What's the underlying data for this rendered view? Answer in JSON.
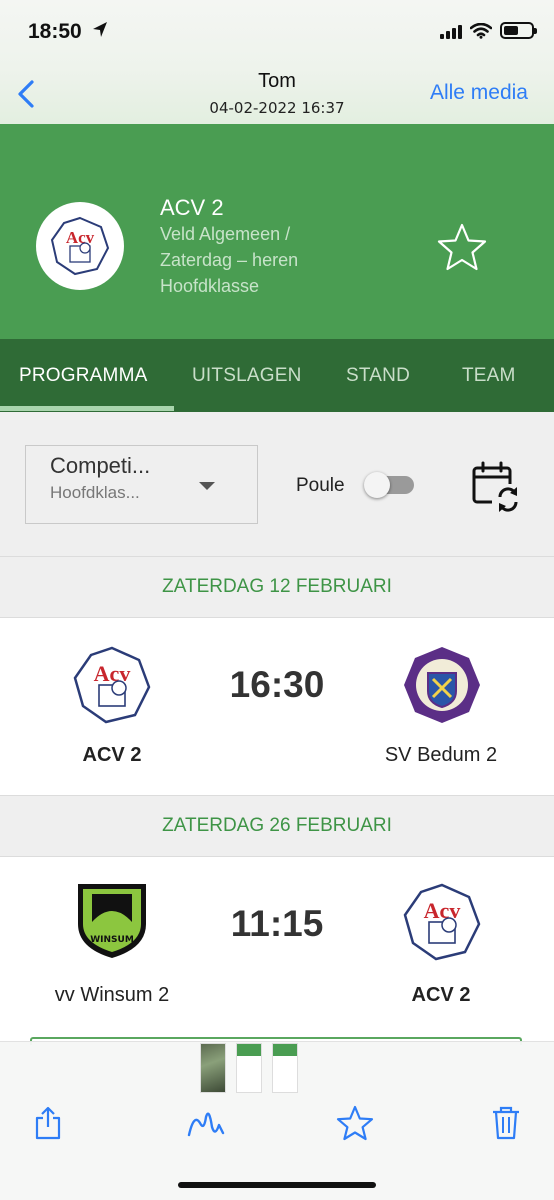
{
  "status_bar": {
    "time": "18:50",
    "icons": [
      "location-arrow-icon",
      "cellular-signal-icon",
      "wifi-icon",
      "battery-icon"
    ]
  },
  "viewer": {
    "title": "Tom",
    "subtitle": "04-02-2022 16:37",
    "right_link": "Alle media",
    "back_icon": "chevron-left-icon"
  },
  "team": {
    "name": "ACV 2",
    "lines": [
      "Veld Algemeen /",
      "Zaterdag – heren",
      "Hoofdklasse"
    ],
    "favorite_icon": "star-outline-icon"
  },
  "tabs": [
    {
      "label": "PROGRAMMA",
      "active": true
    },
    {
      "label": "UITSLAGEN",
      "active": false
    },
    {
      "label": "STAND",
      "active": false
    },
    {
      "label": "TEAM",
      "active": false
    }
  ],
  "filter": {
    "select_main": "Competi...",
    "select_sub": "Hoofdklas...",
    "poule_label": "Poule",
    "poule_on": false,
    "calendar_icon": "calendar-sync-icon"
  },
  "matches": [
    {
      "date": "ZATERDAG 12 FEBRUARI",
      "time": "16:30",
      "home": "ACV 2",
      "away": "SV Bedum 2",
      "home_bold": true,
      "away_bold": false
    },
    {
      "date": "ZATERDAG 26 FEBRUARI",
      "time": "11:15",
      "home": "vv Winsum 2",
      "away": "ACV 2",
      "home_bold": false,
      "away_bold": true
    }
  ],
  "toolbar": {
    "icons": [
      "share-icon",
      "markup-icon",
      "favorite-star-icon",
      "trash-icon"
    ]
  },
  "colors": {
    "brand_green": "#4a9d52",
    "tab_green": "#2f6b36",
    "date_green": "#3e9446",
    "ios_blue": "#2e7df6"
  }
}
